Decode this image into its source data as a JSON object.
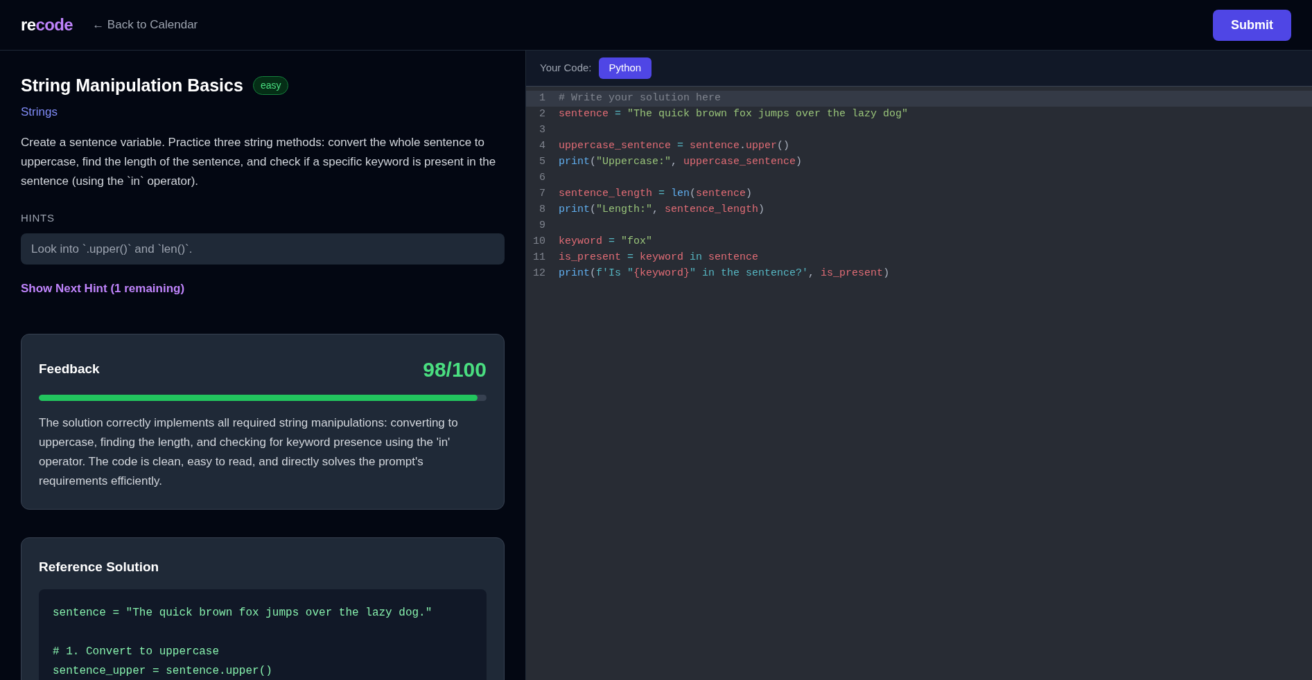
{
  "header": {
    "logo_parts": [
      {
        "text": "re",
        "kind": "plain"
      },
      {
        "text": "code",
        "kind": "accent"
      }
    ],
    "back_link": "← Back to Calendar",
    "submit": "Submit"
  },
  "problem": {
    "title": "String Manipulation Basics",
    "difficulty": "easy",
    "topic": "Strings",
    "description": "Create a sentence variable. Practice three string methods: convert the whole sentence to uppercase, find the length of the sentence, and check if a specific keyword is present in the sentence (using the `in` operator)."
  },
  "hints": {
    "heading": "HINTS",
    "items": [
      "Look into `.upper()` and `len()`."
    ],
    "next_hint": "Show Next Hint (1 remaining)"
  },
  "feedback": {
    "title": "Feedback",
    "score": "98/100",
    "level": 0.98,
    "text": "The solution correctly implements all required string manipulations: converting to uppercase, finding the length, and checking for keyword presence using the 'in' operator. The code is clean, easy to read, and directly solves the prompt's requirements efficiently."
  },
  "reference": {
    "title": "Reference Solution",
    "blocks": [
      [
        "sentence = \"The quick brown fox jumps over the lazy dog.\""
      ],
      [
        "# 1. Convert to uppercase",
        "sentence_upper = sentence.upper()"
      ]
    ]
  },
  "editor": {
    "label": "Your Code:",
    "language": "Python",
    "lines": [
      {
        "number": "1",
        "active": true,
        "tokens": [
          {
            "text": "# Write your solution here",
            "kind": "comment"
          }
        ]
      },
      {
        "number": "2",
        "active": false,
        "tokens": [
          {
            "text": "sentence",
            "kind": "var"
          },
          {
            "text": " = ",
            "kind": "op"
          },
          {
            "text": "\"The quick brown fox jumps over the lazy dog\"",
            "kind": "str"
          }
        ]
      },
      {
        "number": "3",
        "active": false
      },
      {
        "number": "4",
        "active": false,
        "tokens": [
          {
            "text": "uppercase_sentence",
            "kind": "var"
          },
          {
            "text": " = ",
            "kind": "op"
          },
          {
            "text": "sentence",
            "kind": "var"
          },
          {
            "text": ".",
            "kind": "punct"
          },
          {
            "text": "upper",
            "kind": "var"
          },
          {
            "text": "()",
            "kind": "punct"
          }
        ]
      },
      {
        "number": "5",
        "active": false,
        "tokens": [
          {
            "text": "print",
            "kind": "fn"
          },
          {
            "text": "(",
            "kind": "punct"
          },
          {
            "text": "\"Uppercase:\"",
            "kind": "str"
          },
          {
            "text": ", ",
            "kind": "punct"
          },
          {
            "text": "uppercase_sentence",
            "kind": "var"
          },
          {
            "text": ")",
            "kind": "punct"
          }
        ]
      },
      {
        "number": "6",
        "active": false
      },
      {
        "number": "7",
        "active": false,
        "tokens": [
          {
            "text": "sentence_length",
            "kind": "var"
          },
          {
            "text": " = ",
            "kind": "op"
          },
          {
            "text": "len",
            "kind": "fn"
          },
          {
            "text": "(",
            "kind": "punct"
          },
          {
            "text": "sentence",
            "kind": "var"
          },
          {
            "text": ")",
            "kind": "punct"
          }
        ]
      },
      {
        "number": "8",
        "active": false,
        "tokens": [
          {
            "text": "print",
            "kind": "fn"
          },
          {
            "text": "(",
            "kind": "punct"
          },
          {
            "text": "\"Length:\"",
            "kind": "str"
          },
          {
            "text": ", ",
            "kind": "punct"
          },
          {
            "text": "sentence_length",
            "kind": "var"
          },
          {
            "text": ")",
            "kind": "punct"
          }
        ]
      },
      {
        "number": "9",
        "active": false
      },
      {
        "number": "10",
        "active": false,
        "tokens": [
          {
            "text": "keyword",
            "kind": "var"
          },
          {
            "text": " = ",
            "kind": "op"
          },
          {
            "text": "\"fox\"",
            "kind": "str"
          }
        ]
      },
      {
        "number": "11",
        "active": false,
        "tokens": [
          {
            "text": "is_present",
            "kind": "var"
          },
          {
            "text": " = ",
            "kind": "op"
          },
          {
            "text": "keyword",
            "kind": "var"
          },
          {
            "text": " in ",
            "kind": "kw"
          },
          {
            "text": "sentence",
            "kind": "var"
          }
        ]
      },
      {
        "number": "12",
        "active": false,
        "tokens": [
          {
            "text": "print",
            "kind": "fn"
          },
          {
            "text": "(",
            "kind": "punct"
          },
          {
            "text": "f'Is \"",
            "kind": "kw"
          },
          {
            "text": "{keyword}",
            "kind": "var"
          },
          {
            "text": "\" in the sentence?'",
            "kind": "kw"
          },
          {
            "text": ", ",
            "kind": "punct"
          },
          {
            "text": "is_present",
            "kind": "var"
          },
          {
            "text": ")",
            "kind": "punct"
          }
        ]
      }
    ]
  }
}
